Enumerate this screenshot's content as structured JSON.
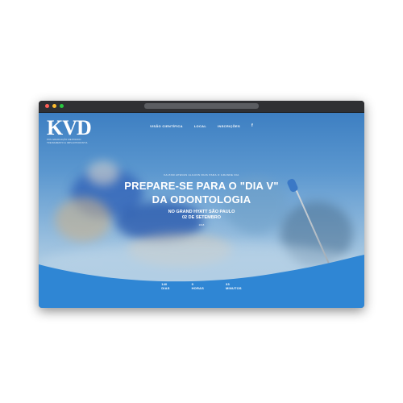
{
  "colors": {
    "brand_blue": "#2f86d4",
    "wave_blue": "#2f86d4",
    "text_white": "#ffffff"
  },
  "window": {
    "traffic_lights": [
      "close",
      "minimize",
      "maximize"
    ]
  },
  "header": {
    "logo_mark": "KVD",
    "logo_sub1": "POS GRADUAÇÃO MESTRADO",
    "logo_sub2": "TREINAMENTO E IMPLANTODONTIA",
    "nav": [
      {
        "label": "VISÃO CIENTÍFICA"
      },
      {
        "label": "LOCAL"
      },
      {
        "label": "INSCRIÇÕES"
      }
    ],
    "facebook_icon": "f"
  },
  "hero": {
    "eyebrow": "FALTAM APENAS ALGUNS DIAS PARA O GRANDE DIA",
    "headline_line1": "PREPARE-SE PARA O \"DIA V\"",
    "headline_line2": "DA ODONTOLOGIA",
    "venue": "NO GRAND HYATT SÃO PAULO",
    "date": "02 DE SETEMBRO",
    "small": "2018"
  },
  "countdown": [
    {
      "value": "140",
      "unit": "DIAS"
    },
    {
      "value": "9",
      "unit": "HORAS"
    },
    {
      "value": "33",
      "unit": "MINUTOS"
    }
  ]
}
